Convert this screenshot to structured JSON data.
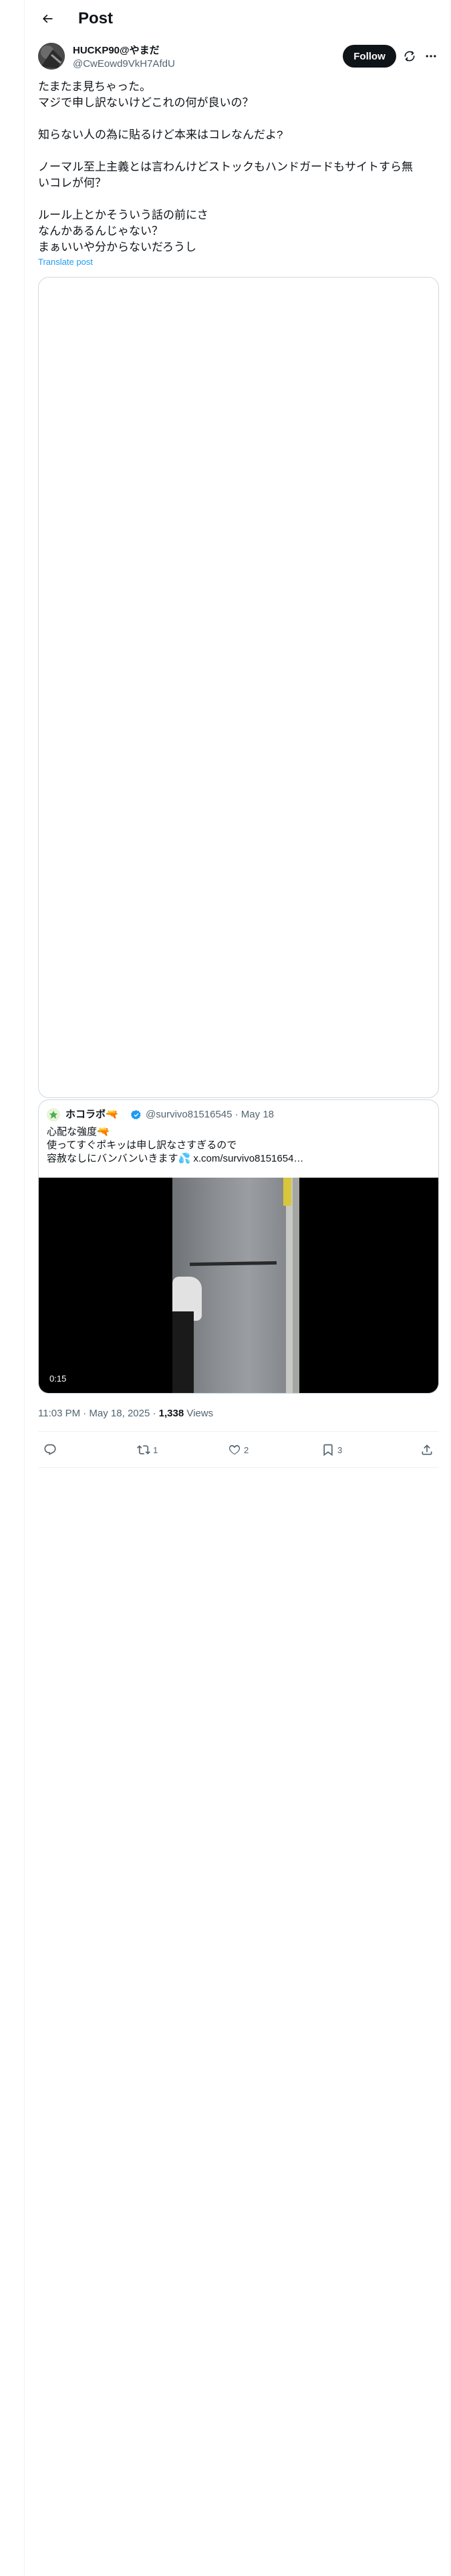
{
  "header": {
    "title": "Post"
  },
  "author": {
    "name": "HUCKP90@やまだ",
    "handle": "@CwEowd9VkH7AfdU"
  },
  "actions_top": {
    "follow_label": "Follow"
  },
  "post": {
    "lines": [
      "たまたま見ちゃった。",
      "マジで申し訳ないけどこれの何が良いの？",
      "",
      "知らない人の為に貼るけど本来はコレなんだよ?",
      "",
      "ノーマル至上主義とは言わんけどストックもハンドガードもサイトすら無",
      "いコレが何？",
      "",
      "ルール上とかそういう話の前にさ",
      "なんかあるんじゃない？",
      "まぁいいや分からないだろうし"
    ],
    "translate_label": "Translate post"
  },
  "quote": {
    "name": "ホコラボ🔫",
    "handle_date": "@survivo81516545 · May 18",
    "lines": [
      "心配な強度🔫",
      "使ってすぐポキッは申し訳なさすぎるので",
      "容赦なしにバンバンいきます💦 x.com/survivo8151654…"
    ],
    "video_time": "0:15"
  },
  "meta": {
    "timestamp": "11:03 PM · May 18, 2025 · ",
    "views_count": "1,338",
    "views_label": " Views"
  },
  "stats": {
    "retweets": "1",
    "likes": "2",
    "bookmarks": "3"
  },
  "icons": [
    "back-arrow-icon",
    "grok-icon",
    "more-icon",
    "verified-badge-icon",
    "reply-icon",
    "retweet-icon",
    "like-icon",
    "bookmark-icon",
    "share-icon"
  ],
  "colors": {
    "accent": "#1d9bf0",
    "text": "#0f1419",
    "secondary": "#536471",
    "border": "#cfd9de"
  }
}
